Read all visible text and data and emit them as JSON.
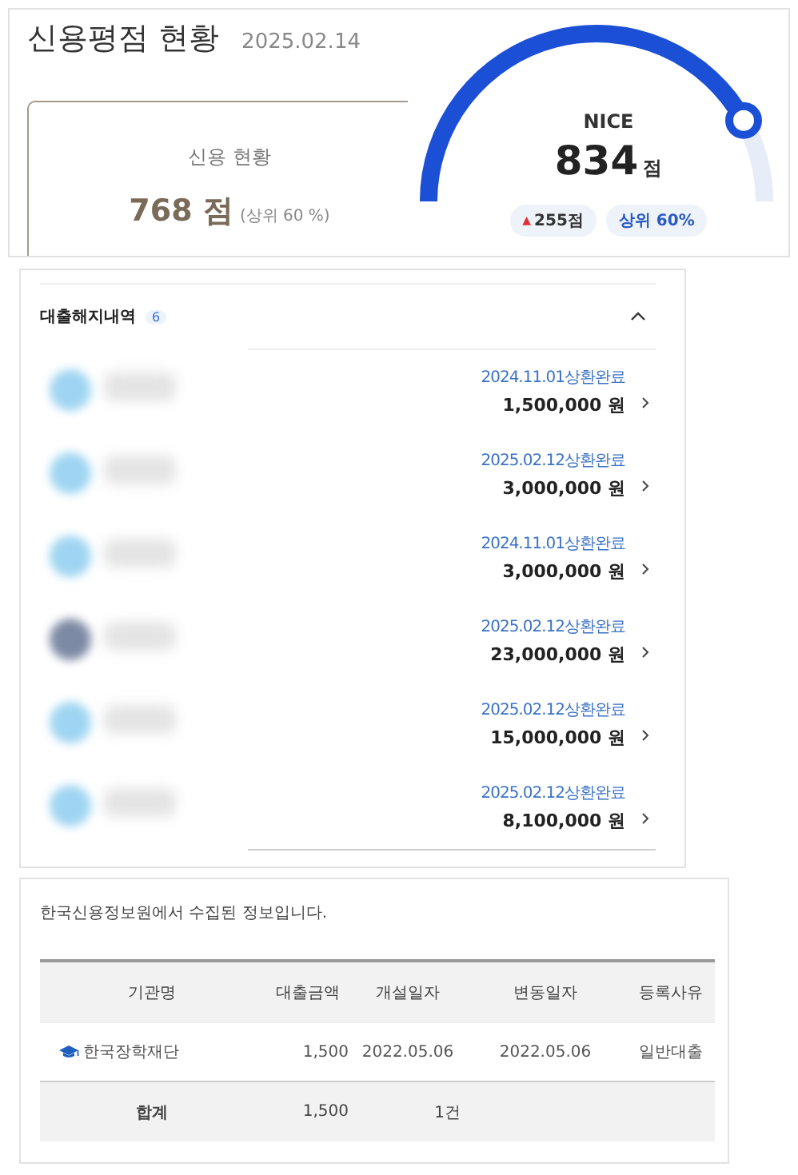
{
  "score_summary": {
    "title": "신용평점 현황",
    "date": "2025.02.14",
    "credit_card": {
      "label": "신용 현황",
      "score": "768",
      "unit": "점",
      "rank": "(상위 60 %)"
    },
    "gauge": {
      "provider": "NICE",
      "score": "834",
      "unit": "점",
      "change_arrow": "▲",
      "change": "255점",
      "rank": "상위 60%"
    }
  },
  "closed_loans": {
    "title": "대출해지내역",
    "count": "6",
    "expanded": true,
    "items": [
      {
        "date_status": "2024.11.01상환완료",
        "amount": "1,500,000 원"
      },
      {
        "date_status": "2025.02.12상환완료",
        "amount": "3,000,000 원"
      },
      {
        "date_status": "2024.11.01상환완료",
        "amount": "3,000,000 원"
      },
      {
        "date_status": "2025.02.12상환완료",
        "amount": "23,000,000 원"
      },
      {
        "date_status": "2025.02.12상환완료",
        "amount": "15,000,000 원"
      },
      {
        "date_status": "2025.02.12상환완료",
        "amount": "8,100,000 원"
      }
    ]
  },
  "loan_table": {
    "source_note": "한국신용정보원에서 수집된 정보입니다.",
    "columns": [
      "기관명",
      "대출금액",
      "개설일자",
      "변동일자",
      "등록사유"
    ],
    "rows": [
      {
        "institution": "한국장학재단",
        "amount": "1,500",
        "opened": "2022.05.06",
        "changed": "2022.05.06",
        "reason": "일반대출"
      }
    ],
    "total": {
      "label": "합계",
      "amount": "1,500",
      "count": "1건"
    }
  }
}
